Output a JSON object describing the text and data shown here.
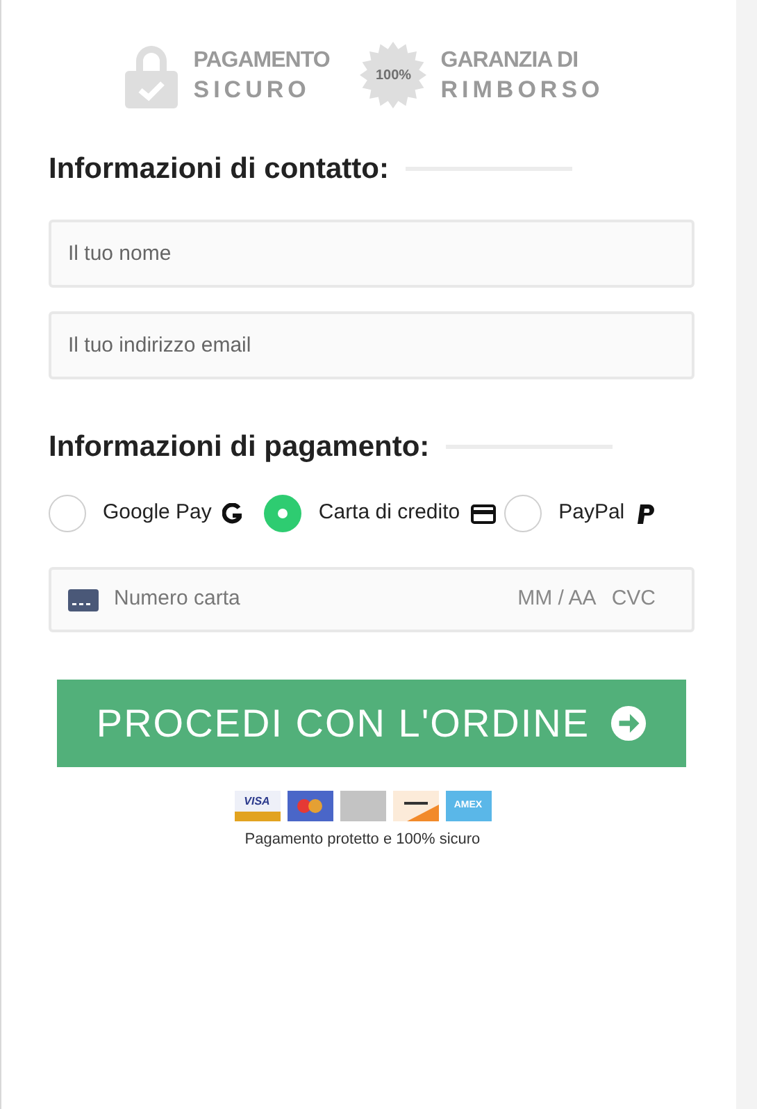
{
  "badges": [
    {
      "kind": "lock",
      "line1": "PAGAMENTO",
      "line2": "SICURO"
    },
    {
      "kind": "seal",
      "seal_text": "100%",
      "line1": "GARANZIA DI",
      "line2": "RIMBORSO"
    }
  ],
  "contact": {
    "heading": "Informazioni di contatto:",
    "fields": [
      {
        "placeholder": "Il tuo nome"
      },
      {
        "placeholder": "Il tuo indirizzo email"
      }
    ]
  },
  "payment": {
    "heading": "Informazioni di pagamento:",
    "methods": [
      {
        "label": "Google Pay",
        "kind": "google",
        "selected": false
      },
      {
        "label": "Carta di credito",
        "kind": "card",
        "selected": true
      },
      {
        "label": "PayPal",
        "kind": "paypal",
        "selected": false
      }
    ],
    "card_field": {
      "number_placeholder": "Numero carta",
      "expiry_placeholder": "MM / AA",
      "cvc_placeholder": "CVC"
    }
  },
  "submit": {
    "label": "PROCEDI CON L'ORDINE"
  },
  "card_logos": [
    {
      "kind": "visa",
      "text": "VISA"
    },
    {
      "kind": "mastercard"
    },
    {
      "kind": "generic"
    },
    {
      "kind": "discover"
    },
    {
      "kind": "amex",
      "text": "AMEX"
    }
  ],
  "footer_note": "Pagamento protetto e 100% sicuro"
}
